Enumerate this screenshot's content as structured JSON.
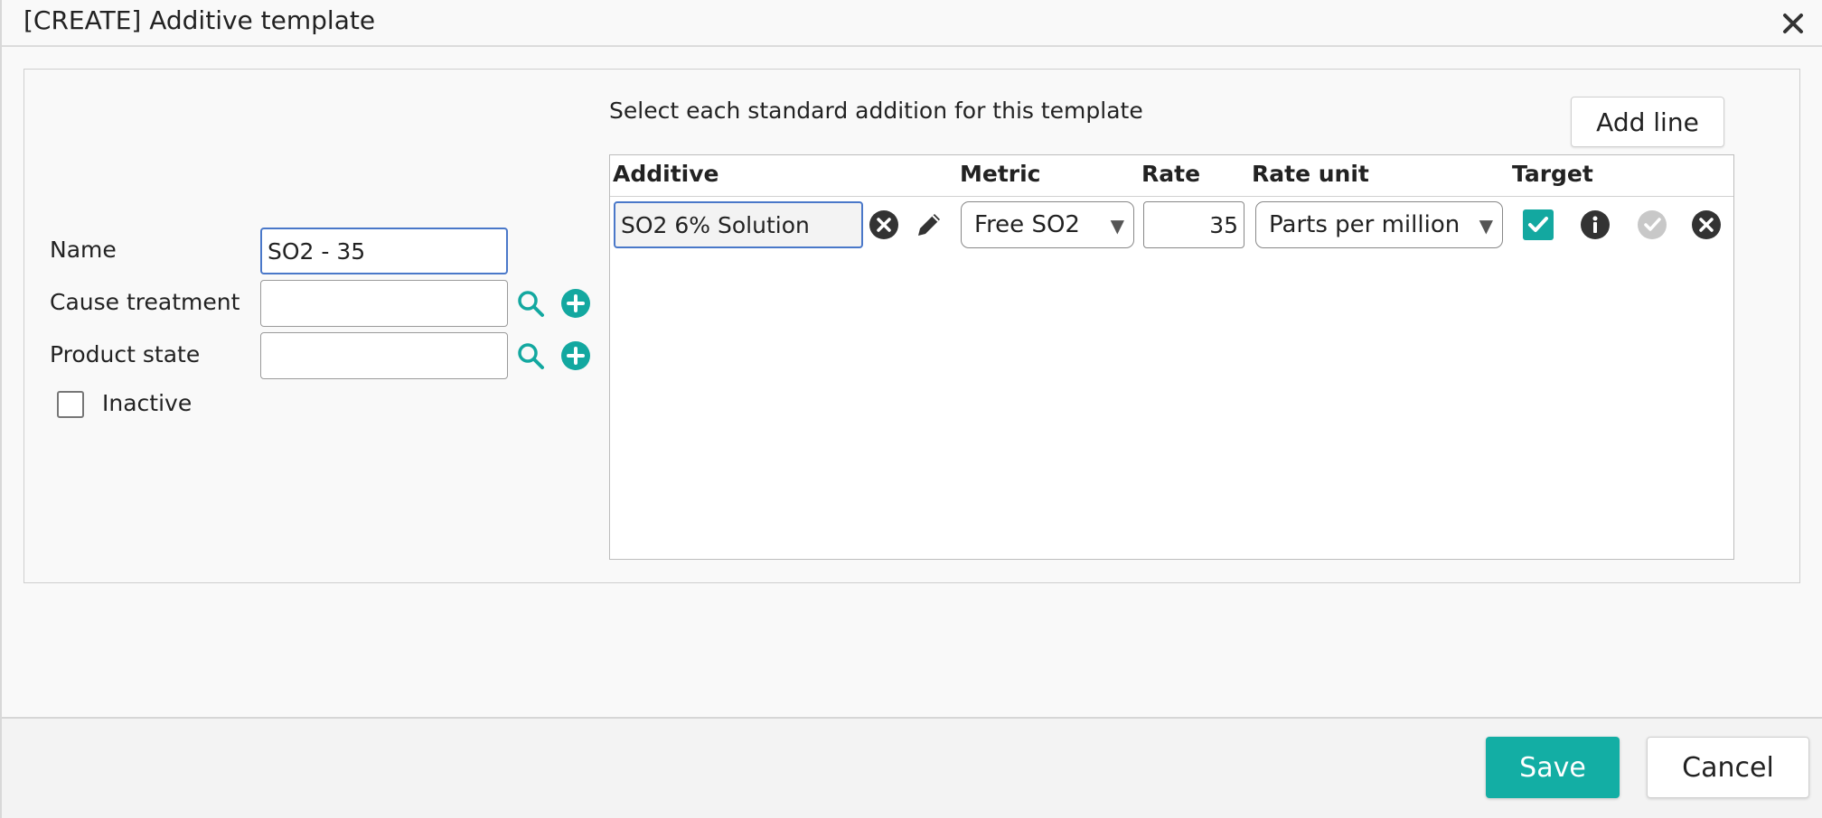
{
  "dialog": {
    "title": "[CREATE] Additive template"
  },
  "form": {
    "name_label": "Name",
    "name_value": "SO2 - 35",
    "cause_label": "Cause treatment",
    "cause_value": "",
    "product_state_label": "Product state",
    "product_state_value": "",
    "inactive_label": "Inactive",
    "inactive_checked": false
  },
  "additions": {
    "instruction": "Select each standard addition for this template",
    "add_line_label": "Add line",
    "columns": [
      "Additive",
      "Metric",
      "Rate",
      "Rate unit",
      "Target"
    ],
    "rows": [
      {
        "additive": "SO2 6% Solution",
        "metric": "Free SO2",
        "rate": "35",
        "rate_unit": "Parts per million",
        "target": true
      }
    ]
  },
  "footer": {
    "save_label": "Save",
    "cancel_label": "Cancel"
  },
  "colors": {
    "accent": "#13aea4",
    "focus": "#4a78c9"
  }
}
